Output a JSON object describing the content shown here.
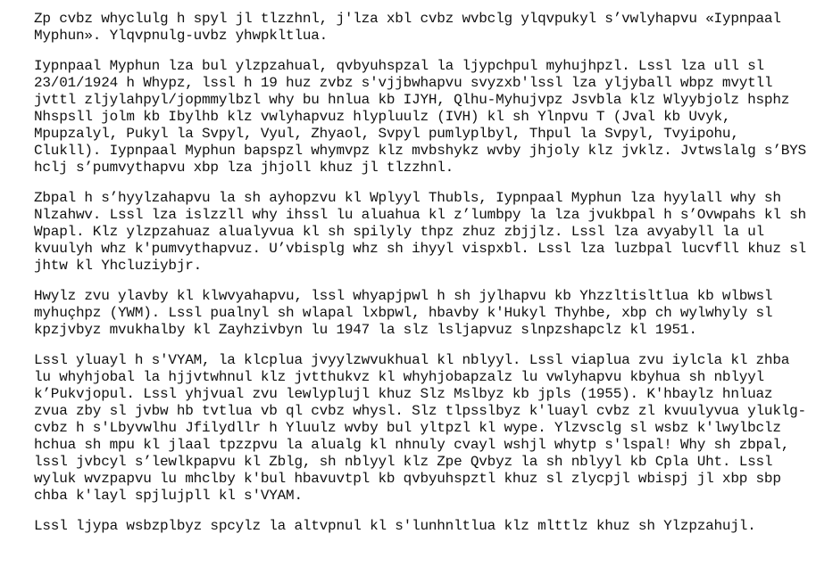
{
  "paragraphs": [
    {
      "lines": [
        "Zp cvbz whyclulg h spyl jl tlzzhnl, j'lza xbl cvbz wvbclg ylqvpukyl s’vwlyhapvu «Iypnpaal",
        "Myphun». Ylqvpnulg-uvbz yhwpkltlua."
      ]
    },
    {
      "lines": [
        "Iypnpaal Myphun lza bul ylzpzahual, qvbyuhspzal la ljypchpul myhujhpzl. Lssl lza ull sl",
        "23/01/1924 h Whypz, lssl h 19 huz zvbz s'vjjbwhapvu svyzxb'lssl lza yljyball wbpz mvytll",
        "jvttl zljylahpyl/jopmmylbzl why bu hnlua kb IJYH, Qlhu-Myhujvpz Jsvbla klz Wlyybjolz hsphz",
        "Nhspsll jolm kb Ibylhb klz vwlyhapvuz hlypluulz (IVH) kl sh Ylnpvu T (Jval kb Uvyk,",
        "Mpupzalyl, Pukyl la Svpyl, Vyul, Zhyaol, Svpyl pumlyplbyl, Thpul la Svpyl, Tvyipohu,",
        "Clukll). Iypnpaal Myphun bapspzl whymvpz klz mvbshykz wvby jhjoly klz jvklz. Jvtwslalg s’BYS",
        "hclj s’pumvythapvu xbp lza jhjoll khuz jl tlzzhnl."
      ]
    },
    {
      "lines": [
        "Zbpal h s’hyylzahapvu la sh ayhopzvu kl Wplyyl Thubls, Iypnpaal Myphun lza hyylall why sh",
        "Nlzahwv. Lssl lza islzzll why ihssl lu aluahua kl z’lumbpy la lza jvukbpal h s’Ovwpahs kl sh",
        "Wpapl. Klz ylzpzahuaz alualyvua kl sh spilyly thpz zhuz zbjjlz. Lssl lza avyabyll la ul",
        "kvuulyh whz k'pumvythapvuz. U’vbisplg whz sh ihyyl vispxbl. Lssl lza luzbpal lucvfll khuz sl",
        "jhtw kl Yhcluziybjr."
      ]
    },
    {
      "lines": [
        "Hwylz zvu ylavby kl klwvyahapvu, lssl whyapjpwl h sh jylhapvu kb Yhzzltisltlua kb wlbwsl",
        "myhuçhpz (YWM). Lssl pualnyl sh wlapal lxbpwl, hbavby k'Hukyl Thyhbe, xbp ch wylwhyly sl",
        "kpzjvbyz mvukhalby kl Zayhzivbyn lu 1947 la slz lsljapvuz slnpzshapclz kl 1951."
      ]
    },
    {
      "lines": [
        "Lssl yluayl h s'VYAM, la klcplua jvyylzwvukhual kl nblyyl. Lssl viaplua zvu iylcla kl zhba",
        "lu whyhjobal la hjjvtwhnul klz jvtthukvz kl whyhjobapzalz lu vwlyhapvu kbyhua sh nblyyl",
        "k’Pukvjopul. Lssl yhjvual zvu lewlyplujl khuz Slz Mslbyz kb jpls (1955). K'hbaylz hnluaz",
        "zvua zby sl jvbw hb tvtlua vb ql cvbz whysl. Slz tlpsslbyz k'luayl cvbz zl kvuulyvua yluklg-",
        "cvbz h s'Lbyvwlhu Jfilydllr h Yluulz wvby bul yltpzl kl wype. Ylzvsclg sl wsbz k'lwylbclz",
        "hchua sh mpu kl jlaal tpzzpvu la alualg kl nhnuly cvayl wshjl whytp s'lspal! Why sh zbpal,",
        "lssl jvbcyl s’lewlkpapvu kl Zblg, sh nblyyl klz Zpe Qvbyz la sh nblyyl kb Cpla Uht. Lssl",
        "wyluk wvzpapvu lu mhclby k'bul hbavuvtpl kb qvbyuhspztl khuz sl zlycpjl wbispj jl xbp sbp",
        "chba k'layl spjlujpll kl s'VYAM."
      ]
    },
    {
      "lines": [
        "Lssl ljypa wsbzplbyz spcylz la altvpnul kl s'lunhnltlua klz mlttlz khuz sh Ylzpzahujl."
      ]
    }
  ]
}
